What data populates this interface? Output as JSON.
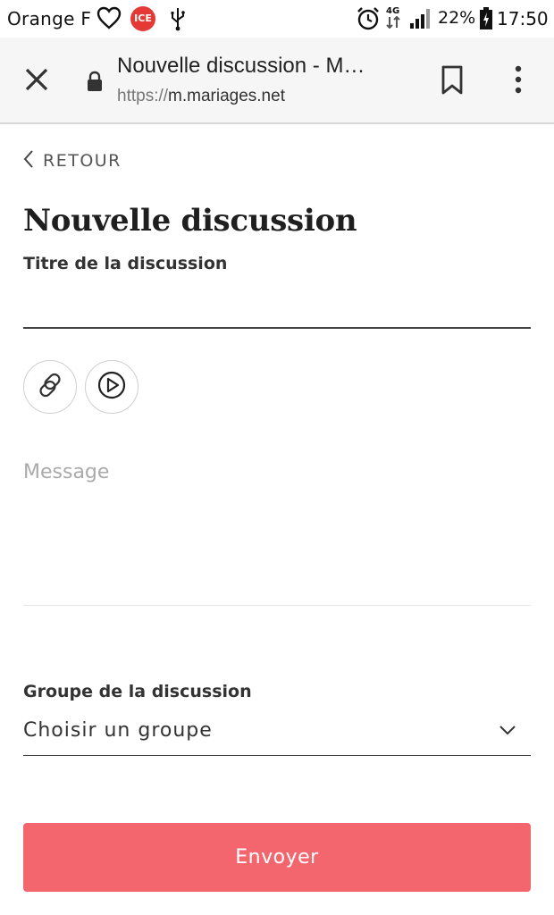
{
  "status_bar": {
    "carrier": "Orange F",
    "battery": "22%",
    "time": "17:50",
    "network": "4G",
    "icons": [
      "heart-icon",
      "ice-icon",
      "usb-icon",
      "alarm-icon",
      "network-4g-icon",
      "signal-icon",
      "battery-icon"
    ]
  },
  "browser": {
    "title": "Nouvelle discussion - M…",
    "url_scheme": "https://",
    "url_host": "m.mariages.net",
    "icons": [
      "close-icon",
      "lock-icon",
      "bookmark-icon",
      "more-vert-icon"
    ]
  },
  "page": {
    "back_label": "RETOUR",
    "title": "Nouvelle discussion",
    "title_field_label": "Titre de la discussion",
    "title_field_value": "",
    "media_buttons": [
      "link-icon",
      "video-icon"
    ],
    "message_placeholder": "Message",
    "group_label": "Groupe de la discussion",
    "group_value": "Choisir un groupe",
    "submit_label": "Envoyer"
  },
  "colors": {
    "accent": "#f3666e",
    "text": "#222222",
    "muted": "#aaaaaa"
  }
}
